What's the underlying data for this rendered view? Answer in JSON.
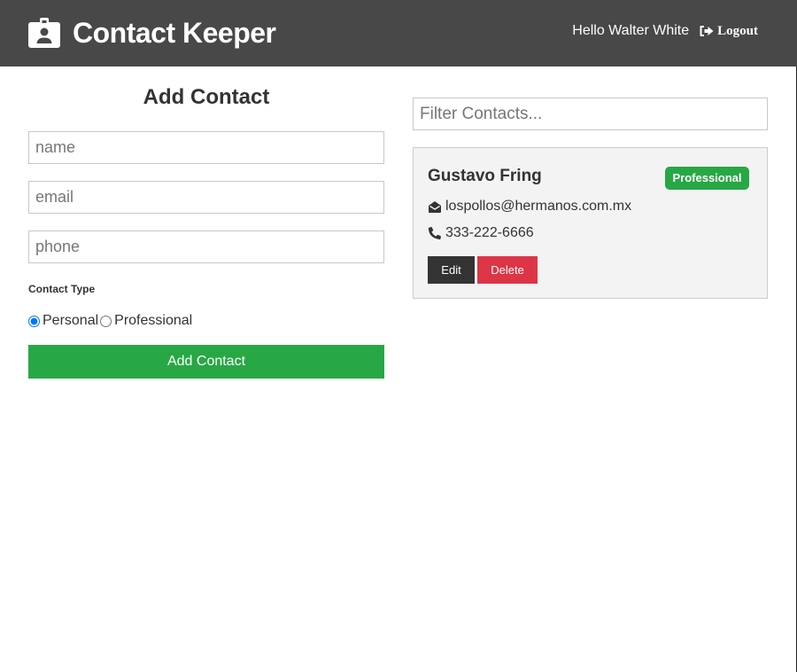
{
  "navbar": {
    "brand_icon": "id-badge-icon",
    "title": "Contact Keeper",
    "greeting": "Hello Walter White",
    "logout_icon": "sign-out-icon",
    "logout_label": "Logout",
    "background": "#484848"
  },
  "form": {
    "title": "Add Contact",
    "name_placeholder": "name",
    "email_placeholder": "email",
    "phone_placeholder": "phone",
    "name_value": "",
    "email_value": "",
    "phone_value": "",
    "type_label": "Contact Type",
    "type_options": [
      {
        "label": "Personal",
        "checked": true
      },
      {
        "label": "Professional",
        "checked": false
      }
    ],
    "submit_label": "Add Contact",
    "submit_color": "#28a745"
  },
  "filter": {
    "placeholder": "Filter Contacts...",
    "value": ""
  },
  "contacts": [
    {
      "name": "Gustavo Fring",
      "type_badge": "Professional",
      "email_icon": "envelope-open-icon",
      "email": "lospollos@hermanos.com.mx",
      "phone_icon": "phone-icon",
      "phone": "333-222-6666",
      "edit_label": "Edit",
      "delete_label": "Delete"
    }
  ],
  "colors": {
    "success": "#28a745",
    "danger": "#dc3545",
    "dark": "#333333",
    "card_bg": "#f3f3f3"
  }
}
